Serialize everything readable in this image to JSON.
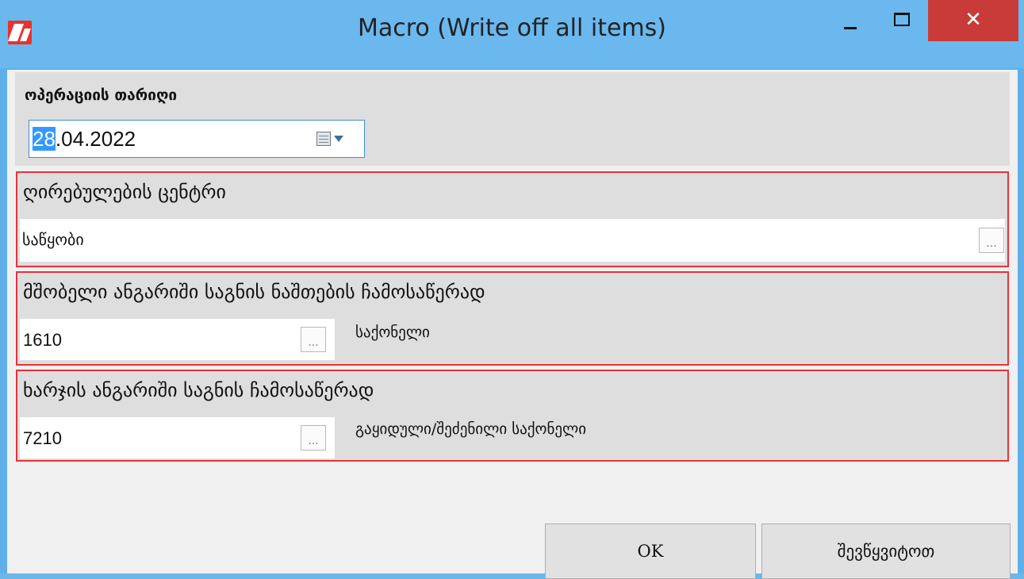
{
  "window": {
    "title": "Macro (Write off all items)",
    "close_glyph": "✕"
  },
  "date": {
    "label": "ოპერაციის თარიღი",
    "value_selected": "28",
    "value_rest": ".04.2022"
  },
  "cost_center": {
    "label": "ღირებულების ცენტრი",
    "value": "საწყობი"
  },
  "parent_account": {
    "label": "მშობელი ანგარიში საგნის ნაშთების ჩამოსაწერად",
    "code": "1610",
    "name": "საქონელი"
  },
  "expense_account": {
    "label": "ხარჯის ანგარიში საგნის  ჩამოსაწერად",
    "code": "7210",
    "name": "გაყიდული/შეძენილი საქონელი"
  },
  "ellipsis": "...",
  "buttons": {
    "ok": "OK",
    "cancel": "შევწყვიტოთ"
  },
  "colors": {
    "titlebar": "#6ab8ee",
    "close_button": "#c83b39",
    "group_border": "#e8323a",
    "selection": "#3399ff"
  }
}
